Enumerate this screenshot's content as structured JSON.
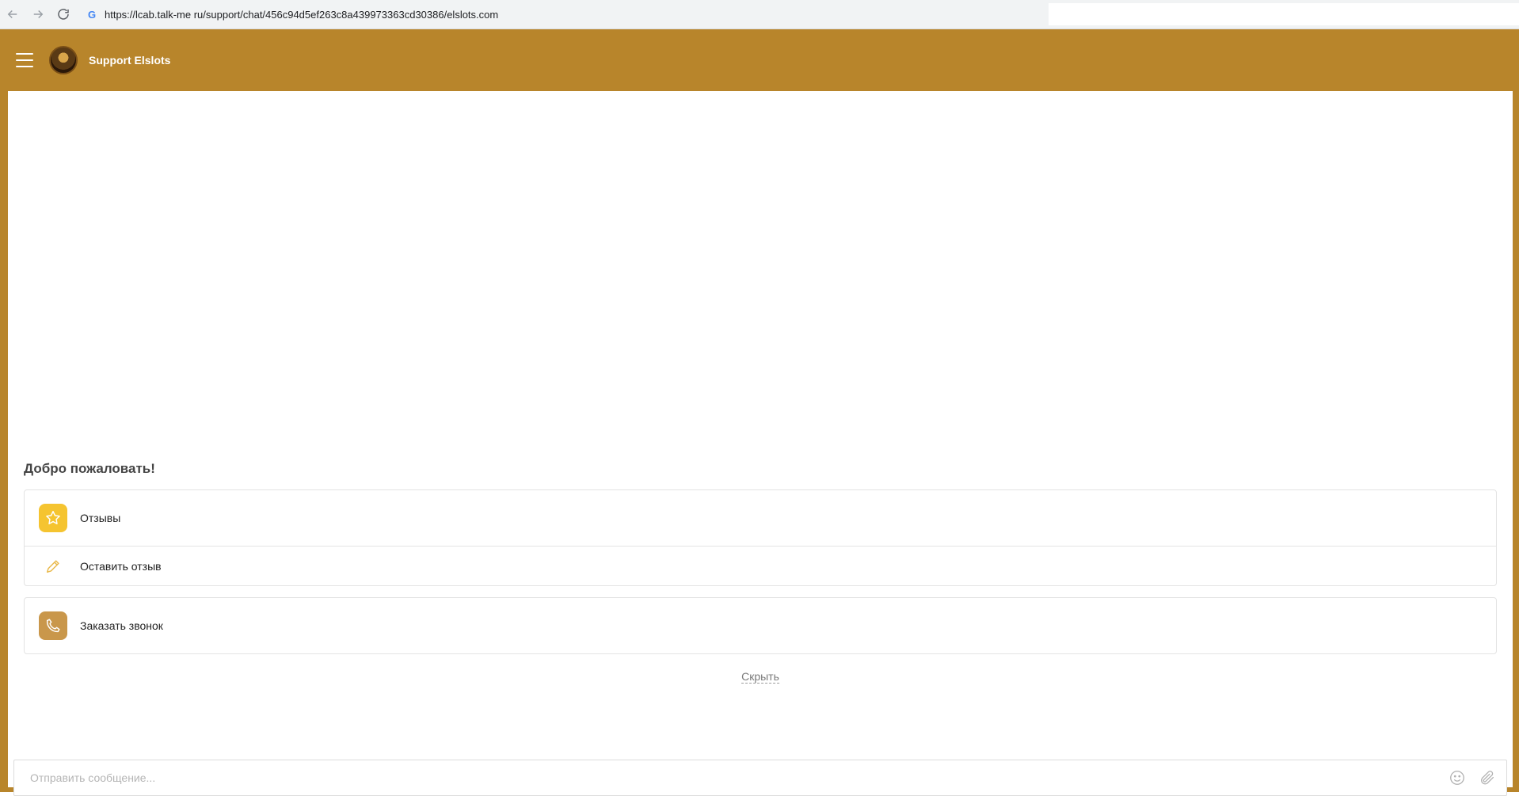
{
  "browser": {
    "url": "https://lcab.talk-me ru/support/chat/456c94d5ef263c8a439973363cd30386/elslots.com"
  },
  "header": {
    "title": "Support Elslots"
  },
  "chat": {
    "welcome": "Добро пожаловать!",
    "items": [
      {
        "label": "Отзывы",
        "icon": "star-icon"
      },
      {
        "label": "Оставить отзыв",
        "icon": "pencil-icon"
      },
      {
        "label": "Заказать звонок",
        "icon": "phone-icon"
      }
    ],
    "hide_label": "Скрыть"
  },
  "composer": {
    "placeholder": "Отправить сообщение..."
  },
  "colors": {
    "brand": "#b8852b",
    "star_accent": "#f5c430",
    "phone_accent": "#c9974b"
  }
}
